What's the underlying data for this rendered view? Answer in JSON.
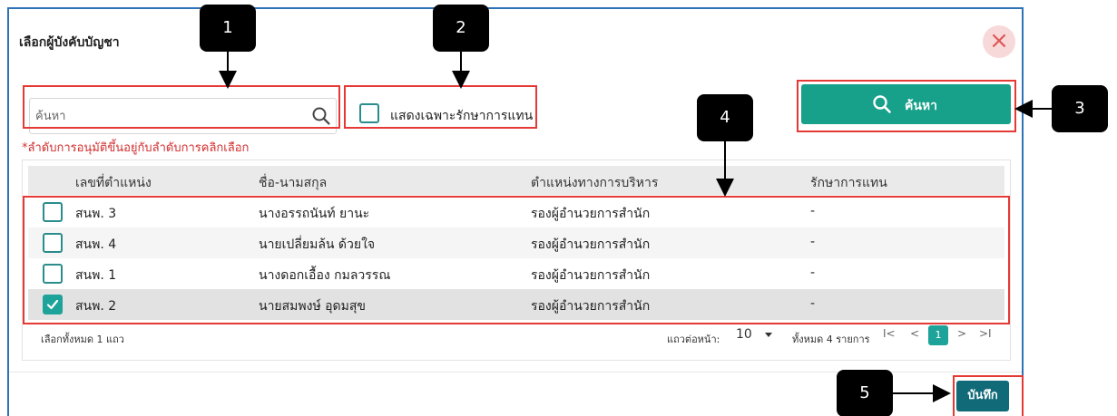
{
  "dialog": {
    "title": "เลือกผู้บังคับบัญชา",
    "close_icon": "close-icon",
    "close_glyph": "×"
  },
  "search": {
    "placeholder": "ค้นหา",
    "value": "",
    "icon": "search-icon"
  },
  "acting_only": {
    "label": "แสดงเฉพาะรักษาการแทน",
    "checked": false
  },
  "search_button": {
    "label": "ค้นหา",
    "icon": "search-icon"
  },
  "note": "*ลำดับการอนุมัติขึ้นอยู่กับลำดับการคลิกเลือก",
  "table": {
    "columns": [
      "เลขที่ตำแหน่ง",
      "ชื่อ-นามสกุล",
      "ตำแหน่งทางการบริหาร",
      "รักษาการแทน"
    ],
    "rows": [
      {
        "checked": false,
        "position_no": "สนพ. 3",
        "name": "นางอรรถนันท์ ยานะ",
        "admin_position": "รองผู้อำนวยการสำนัก",
        "acting": "-"
      },
      {
        "checked": false,
        "position_no": "สนพ. 4",
        "name": "นายเปลี่ยมล้น ด้วยใจ",
        "admin_position": "รองผู้อำนวยการสำนัก",
        "acting": "-"
      },
      {
        "checked": false,
        "position_no": "สนพ. 1",
        "name": "นางดอกเอื้อง กมลวรรณ",
        "admin_position": "รองผู้อำนวยการสำนัก",
        "acting": "-"
      },
      {
        "checked": true,
        "position_no": "สนพ. 2",
        "name": "นายสมพงษ์ อุดมสุข",
        "admin_position": "รองผู้อำนวยการสำนัก",
        "acting": "-"
      }
    ]
  },
  "footer": {
    "selected_text": "เลือกทั้งหมด 1 แถว",
    "per_page_label": "แถวต่อหน้า:",
    "per_page_value": "10",
    "total_text": "ทั้งหมด 4 รายการ",
    "first_glyph": "I<",
    "prev_glyph": "<",
    "current_page": "1",
    "next_glyph": ">",
    "last_glyph": ">I"
  },
  "save_button": {
    "label": "บันทึก"
  },
  "callouts": [
    "1",
    "2",
    "3",
    "4",
    "5"
  ],
  "colors": {
    "primary": "#17a08a",
    "save": "#116a78",
    "highlight_border": "#e53935",
    "dialog_border": "#2f73b7",
    "callout_bg": "#000000"
  }
}
